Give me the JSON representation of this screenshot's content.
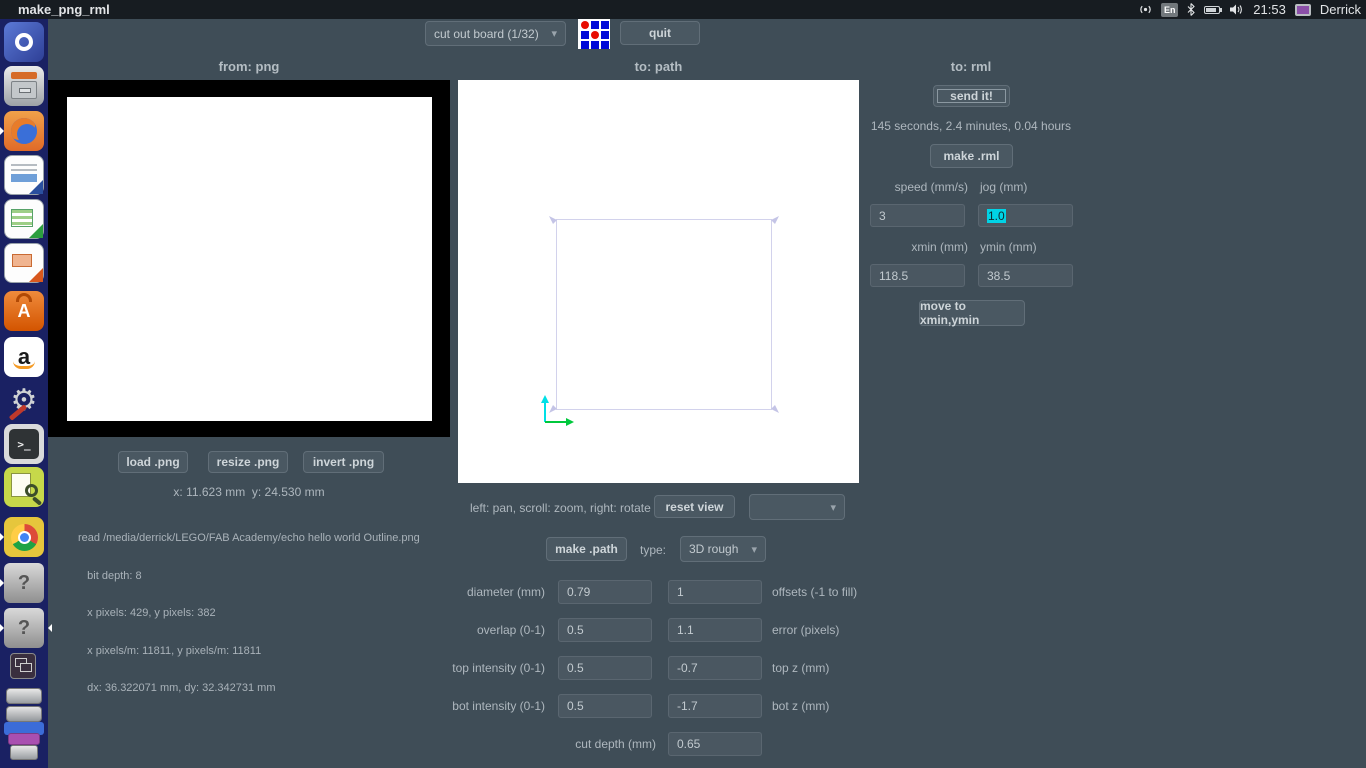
{
  "topbar": {
    "title": "make_png_rml",
    "keyboard_layout": "En",
    "time": "21:53",
    "user": "Derrick",
    "indicator_icons": [
      "network-icon",
      "keyboard-indicator",
      "bluetooth-icon",
      "battery-icon",
      "volume-icon",
      "display-icon"
    ]
  },
  "launcher": {
    "items": [
      "ubuntu-dash",
      "file-manager",
      "firefox",
      "libreoffice-writer",
      "libreoffice-calc",
      "libreoffice-impress",
      "software-center",
      "amazon",
      "system-settings",
      "terminal",
      "image-magnifier",
      "chrome",
      "unknown-app-1",
      "unknown-app-2",
      "workspace-switcher",
      "mounted-drives"
    ]
  },
  "toolbar": {
    "preset": "cut out board (1/32)",
    "quit_label": "quit"
  },
  "png_panel": {
    "title": "from: png",
    "load_label": "load .png",
    "resize_label": "resize .png",
    "invert_label": "invert .png",
    "cursor_readout": "x: 11.623 mm  y: 24.530 mm",
    "info_lines": [
      "read /media/derrick/LEGO/FAB Academy/echo hello world Outline.png",
      "   bit depth: 8",
      "   x pixels: 429, y pixels: 382",
      "   x pixels/m: 11811, y pixels/m: 11811",
      "   dx: 36.322071 mm, dy: 32.342731 mm"
    ]
  },
  "path_panel": {
    "title": "to: path",
    "hint": "left: pan, scroll: zoom, right: rotate",
    "reset_label": "reset view",
    "view_dropdown_value": "",
    "make_label": "make .path",
    "type_label": "type:",
    "type_value": "3D rough",
    "params": [
      {
        "label_left": "diameter (mm)",
        "value_left": "0.79",
        "value_right": "1",
        "label_right": "offsets (-1 to fill)"
      },
      {
        "label_left": "overlap (0-1)",
        "value_left": "0.5",
        "value_right": "1.1",
        "label_right": "error (pixels)"
      },
      {
        "label_left": "top intensity (0-1)",
        "value_left": "0.5",
        "value_right": "-0.7",
        "label_right": "top z (mm)"
      },
      {
        "label_left": "bot intensity (0-1)",
        "value_left": "0.5",
        "value_right": "-1.7",
        "label_right": "bot z (mm)"
      }
    ],
    "cut_depth_label": "cut depth (mm)",
    "cut_depth_value": "0.65"
  },
  "rml_panel": {
    "title": "to: rml",
    "send_label": "send it!",
    "duration": "145 seconds, 2.4 minutes, 0.04 hours",
    "make_label": "make .rml",
    "speed_label": "speed (mm/s)",
    "jog_label": "jog (mm)",
    "speed_value": "3",
    "jog_value": "1.0",
    "xmin_label": "xmin (mm)",
    "ymin_label": "ymin (mm)",
    "xmin_value": "118.5",
    "ymin_value": "38.5",
    "move_label": "move to xmin,ymin"
  },
  "colors": {
    "app_background": "#3f4d57",
    "selection_cyan": "#00d3e6",
    "path_stroke": "#d2d2ec",
    "axis_y_cyan": "#00e0e6",
    "axis_x_green": "#00c83c",
    "logo_red": "#e80c00",
    "logo_blue": "#0008d8"
  }
}
